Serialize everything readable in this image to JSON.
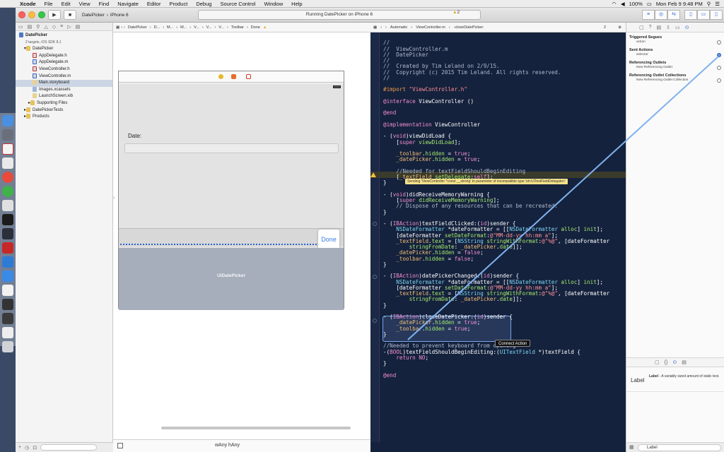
{
  "menubar": {
    "app": "Xcode",
    "items": [
      "File",
      "Edit",
      "View",
      "Find",
      "Navigate",
      "Editor",
      "Product",
      "Debug",
      "Source Control",
      "Window",
      "Help"
    ],
    "battery": "100%",
    "clock": "Mon Feb 9  9:48 PM"
  },
  "toolbar": {
    "scheme": "DatePicker",
    "device": "iPhone 6",
    "status": "Running DatePicker on iPhone 6",
    "warnings": "2"
  },
  "navigator": {
    "project": "DatePicker",
    "project_sub": "2 targets, iOS SDK 8.1",
    "items": [
      {
        "label": "DatePicker"
      },
      {
        "label": "AppDelegate.h"
      },
      {
        "label": "AppDelegate.m"
      },
      {
        "label": "ViewController.h"
      },
      {
        "label": "ViewController.m"
      },
      {
        "label": "Main.storyboard"
      },
      {
        "label": "Images.xcassets"
      },
      {
        "label": "LaunchScreen.xib"
      },
      {
        "label": "Supporting Files"
      },
      {
        "label": "DatePickerTests"
      },
      {
        "label": "Products"
      }
    ]
  },
  "ib": {
    "jump": [
      "DatePicker",
      "D...",
      "M...",
      "M...",
      "V...",
      "V...",
      "V...",
      "Toolbar",
      "Done"
    ],
    "scene": {
      "date_label": "Date:",
      "done": "Done",
      "picker": "UIDatePicker"
    },
    "size_class": "wAny hAny",
    "breadcrumb": "DatePicker"
  },
  "editor": {
    "jump": [
      "Automatic",
      "ViewController.m",
      "-closeDatePicker:"
    ],
    "counter": "2",
    "warning": "Sending 'ViewController *const __strong' to parameter of incompatible type 'id<UITextFieldDelegate>'",
    "connect_tip": "Connect Action"
  },
  "inspector": {
    "sections": [
      {
        "title": "Triggered Segues",
        "rows": [
          {
            "label": "action",
            "active": false
          }
        ]
      },
      {
        "title": "Sent Actions",
        "rows": [
          {
            "label": "selector",
            "active": true
          }
        ]
      },
      {
        "title": "Referencing Outlets",
        "rows": [
          {
            "label": "New Referencing Outlet",
            "active": false
          }
        ]
      },
      {
        "title": "Referencing Outlet Collections",
        "rows": [
          {
            "label": "New Referencing Outlet Collection",
            "active": false
          }
        ]
      }
    ],
    "library_item_name": "Label",
    "library_item_bold": "Label",
    "library_item_desc": " - A variably sized amount of static text.",
    "filter": "Label"
  }
}
